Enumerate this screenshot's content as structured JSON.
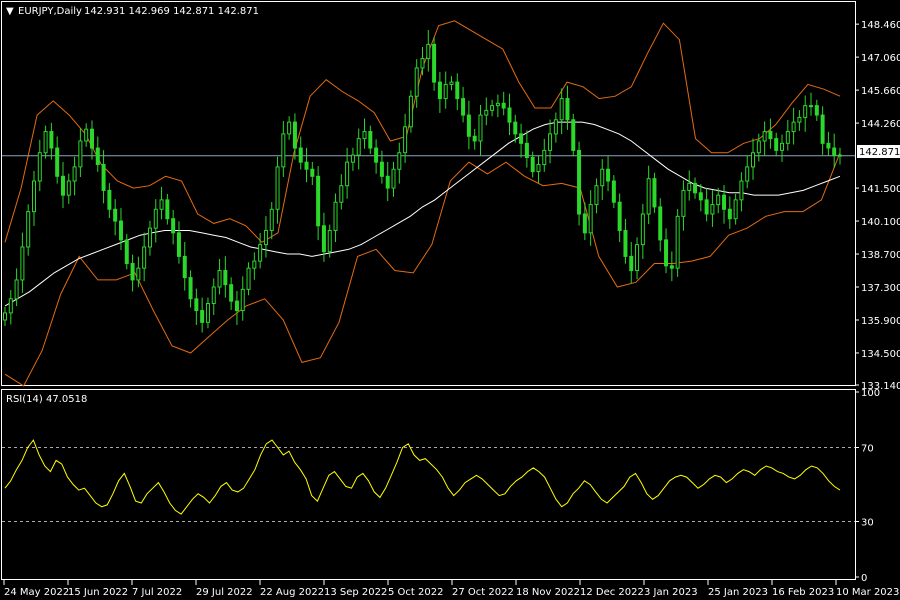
{
  "header": {
    "menu_glyph": "▼",
    "symbol_timeframe": "EURJPY,Daily",
    "ohlc": "142.931 142.969 142.871 142.871"
  },
  "price_label": "142.871",
  "colors": {
    "background": "#000000",
    "bull_candle": "#2bd82b",
    "bollinger": "#e46c12",
    "moving_average": "#ffffff",
    "rsi_line": "#ffff00",
    "grid_dashed": "#aaaaaa",
    "axis": "#ffffff",
    "current_price_line": "#8aa6c0"
  },
  "rsi_panel": {
    "title": "RSI(14) 47.0518",
    "levels": [
      70,
      30
    ],
    "ticks": [
      "100",
      "70",
      "30",
      "0"
    ]
  },
  "chart_data": [
    {
      "type": "candlestick",
      "ylim": [
        133.14,
        149.4
      ],
      "y_ticks": [
        "148.460",
        "147.060",
        "145.660",
        "144.260",
        "142.871",
        "141.500",
        "140.100",
        "138.700",
        "137.300",
        "135.900",
        "134.500",
        "133.140"
      ],
      "x_ticks": [
        "24 May 2022",
        "15 Jun 2022",
        "7 Jul 2022",
        "29 Jul 2022",
        "22 Aug 2022",
        "13 Sep 2022",
        "5 Oct 2022",
        "27 Oct 2022",
        "18 Nov 2022",
        "12 Dec 2022",
        "3 Jan 2023",
        "25 Jan 2023",
        "16 Feb 2023",
        "10 Mar 2023"
      ],
      "close": [
        136.2,
        136.8,
        137.6,
        139.0,
        140.5,
        141.8,
        143.0,
        143.9,
        143.2,
        142.0,
        141.2,
        141.8,
        142.4,
        143.5,
        144.0,
        143.2,
        142.5,
        141.4,
        140.6,
        140.1,
        139.3,
        138.3,
        137.6,
        138.1,
        139.0,
        139.8,
        140.6,
        141.0,
        140.2,
        139.6,
        138.6,
        137.7,
        136.8,
        136.3,
        135.8,
        136.6,
        137.3,
        138.0,
        137.4,
        136.7,
        136.3,
        137.2,
        138.1,
        138.4,
        139.1,
        139.7,
        140.6,
        142.4,
        143.8,
        144.3,
        143.2,
        142.6,
        142.3,
        142.0,
        139.9,
        138.8,
        139.7,
        140.9,
        141.6,
        142.6,
        142.9,
        143.6,
        143.9,
        143.2,
        142.6,
        142.0,
        141.5,
        142.3,
        143.0,
        144.1,
        145.4,
        146.6,
        147.0,
        147.6,
        146.0,
        145.3,
        145.9,
        146.0,
        145.3,
        144.6,
        143.7,
        143.5,
        144.6,
        144.8,
        145.0,
        145.1,
        144.9,
        144.3,
        143.8,
        143.4,
        142.8,
        142.2,
        142.5,
        143.1,
        143.8,
        144.4,
        145.3,
        144.4,
        143.1,
        140.4,
        139.6,
        140.8,
        141.6,
        142.3,
        141.8,
        140.9,
        139.7,
        138.6,
        138.0,
        139.1,
        140.4,
        141.9,
        140.7,
        139.3,
        138.2,
        138.1,
        140.3,
        141.4,
        141.7,
        141.3,
        141.0,
        140.4,
        140.8,
        141.2,
        140.6,
        140.2,
        141.0,
        141.8,
        142.4,
        143.0,
        143.5,
        143.9,
        143.6,
        143.1,
        143.4,
        143.9,
        144.3,
        144.5,
        145.0,
        145.0,
        144.6,
        143.4,
        143.2,
        142.9,
        142.871
      ],
      "ma": [
        136.5,
        136.8,
        137.1,
        137.5,
        137.9,
        138.2,
        138.5,
        138.7,
        138.9,
        139.1,
        139.3,
        139.5,
        139.6,
        139.7,
        139.7,
        139.7,
        139.6,
        139.5,
        139.4,
        139.2,
        139.0,
        138.9,
        138.8,
        138.7,
        138.7,
        138.6,
        138.7,
        138.8,
        138.9,
        139.1,
        139.4,
        139.7,
        140.0,
        140.3,
        140.7,
        141.0,
        141.4,
        141.8,
        142.2,
        142.6,
        143.0,
        143.4,
        143.7,
        144.0,
        144.2,
        144.3,
        144.3,
        144.3,
        144.2,
        144.0,
        143.8,
        143.5,
        143.1,
        142.7,
        142.3,
        142.0,
        141.7,
        141.5,
        141.4,
        141.3,
        141.3,
        141.2,
        141.2,
        141.2,
        141.3,
        141.4,
        141.6,
        141.8,
        142.0
      ],
      "bb_upper": [
        139.2,
        141.5,
        144.6,
        145.2,
        144.6,
        143.8,
        142.5,
        141.8,
        141.5,
        141.6,
        142.0,
        141.8,
        140.4,
        140.0,
        140.2,
        139.9,
        139.2,
        139.6,
        143.0,
        145.4,
        146.1,
        145.6,
        145.2,
        144.7,
        143.5,
        143.7,
        146.6,
        148.4,
        148.6,
        148.2,
        147.8,
        147.4,
        146.0,
        144.9,
        144.9,
        146.0,
        145.8,
        145.3,
        145.4,
        145.8,
        147.2,
        148.5,
        147.8,
        143.6,
        143.0,
        143.0,
        143.4,
        143.6,
        144.2,
        145.1,
        145.9,
        145.7,
        145.4
      ],
      "bb_lower": [
        133.6,
        133.1,
        134.6,
        137.0,
        138.6,
        137.6,
        137.6,
        137.9,
        136.3,
        134.8,
        134.5,
        135.2,
        135.9,
        136.5,
        136.8,
        135.9,
        134.1,
        134.3,
        135.8,
        138.6,
        138.9,
        138.0,
        137.9,
        139.1,
        141.8,
        142.6,
        142.1,
        142.6,
        142.0,
        141.6,
        141.7,
        141.5,
        138.6,
        137.3,
        137.5,
        138.3,
        138.3,
        138.4,
        138.6,
        139.5,
        139.8,
        140.3,
        140.5,
        140.5,
        141.0,
        143.0
      ],
      "series": []
    },
    {
      "type": "line",
      "name": "RSI(14)",
      "ylim": [
        0,
        100
      ],
      "values": [
        48,
        52,
        58,
        63,
        70,
        74,
        66,
        60,
        57,
        63,
        61,
        54,
        50,
        47,
        48,
        44,
        40,
        38,
        39,
        45,
        52,
        56,
        49,
        41,
        40,
        45,
        48,
        51,
        46,
        40,
        36,
        34,
        38,
        42,
        45,
        43,
        40,
        44,
        49,
        51,
        47,
        46,
        48,
        53,
        58,
        66,
        72,
        74,
        70,
        66,
        68,
        62,
        58,
        53,
        44,
        41,
        48,
        55,
        57,
        53,
        49,
        48,
        54,
        56,
        52,
        46,
        43,
        48,
        55,
        62,
        70,
        72,
        66,
        63,
        64,
        61,
        58,
        54,
        48,
        44,
        47,
        51,
        53,
        55,
        53,
        50,
        47,
        44,
        45,
        49,
        52,
        54,
        57,
        59,
        57,
        54,
        48,
        42,
        38,
        40,
        45,
        48,
        52,
        50,
        46,
        42,
        40,
        43,
        46,
        49,
        54,
        56,
        51,
        45,
        42,
        44,
        48,
        52,
        54,
        55,
        54,
        51,
        48,
        50,
        53,
        55,
        54,
        51,
        53,
        56,
        58,
        57,
        55,
        58,
        60,
        59,
        57,
        56,
        54,
        53,
        55,
        58,
        60,
        59,
        56,
        52,
        49,
        47
      ]
    }
  ]
}
